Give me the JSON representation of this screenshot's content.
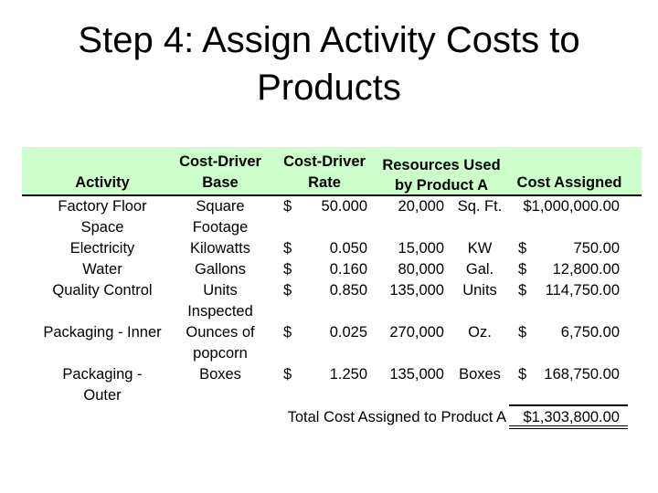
{
  "slide": {
    "title_line1": "Step 4:  Assign Activity Costs to",
    "title_line2": "Products"
  },
  "table": {
    "header_color": "#ccffcc",
    "columns": {
      "activity": "Activity",
      "base_line1": "Cost-Driver",
      "base_line2": "Base",
      "rate_line1": "Cost-Driver",
      "rate_line2": "Rate",
      "resources_line1": "Resources Used",
      "resources_line2": "by Product A",
      "assigned": "Cost Assigned"
    },
    "rows": [
      {
        "activity": [
          "Factory Floor",
          "Space"
        ],
        "base": [
          "Square",
          "Footage"
        ],
        "rate_currency": "$",
        "rate": "50.000",
        "quantity": "20,000",
        "unit": "Sq. Ft.",
        "assigned_currency": "",
        "assigned": "$1,000,000.00"
      },
      {
        "activity": [
          "Electricity"
        ],
        "base": [
          "Kilowatts"
        ],
        "rate_currency": "$",
        "rate": "0.050",
        "quantity": "15,000",
        "unit": "KW",
        "assigned_currency": "$",
        "assigned": "750.00"
      },
      {
        "activity": [
          "Water"
        ],
        "base": [
          "Gallons"
        ],
        "rate_currency": "$",
        "rate": "0.160",
        "quantity": "80,000",
        "unit": "Gal.",
        "assigned_currency": "$",
        "assigned": "12,800.00"
      },
      {
        "activity": [
          "Quality Control"
        ],
        "base": [
          "Units",
          "Inspected"
        ],
        "rate_currency": "$",
        "rate": "0.850",
        "quantity": "135,000",
        "unit": "Units",
        "assigned_currency": "$",
        "assigned": "114,750.00"
      },
      {
        "activity": [
          "Packaging - Inner"
        ],
        "base": [
          "Ounces of",
          "popcorn"
        ],
        "rate_currency": "$",
        "rate": "0.025",
        "quantity": "270,000",
        "unit": "Oz.",
        "assigned_currency": "$",
        "assigned": "6,750.00"
      },
      {
        "activity": [
          "Packaging -",
          "Outer"
        ],
        "base": [
          "Boxes"
        ],
        "rate_currency": "$",
        "rate": "1.250",
        "quantity": "135,000",
        "unit": "Boxes",
        "assigned_currency": "$",
        "assigned": "168,750.00"
      }
    ],
    "total_label": "Total Cost Assigned to Product A",
    "total_value": "$1,303,800.00"
  }
}
